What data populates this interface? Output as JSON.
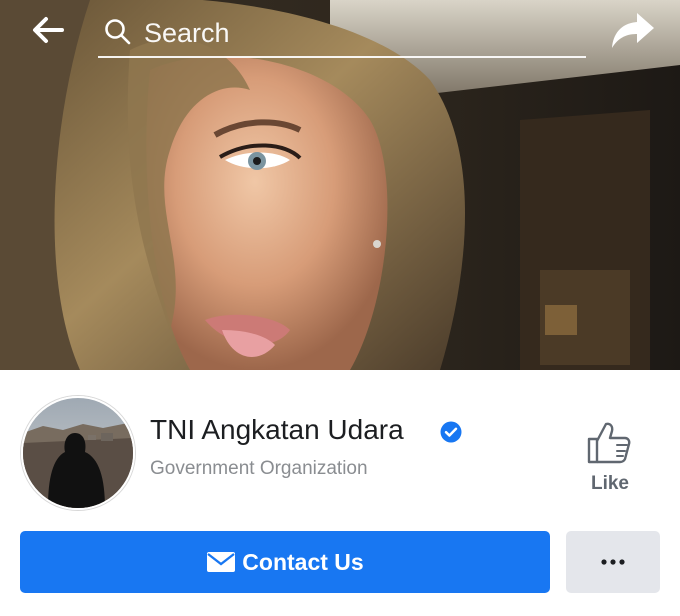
{
  "header": {
    "back_icon": "arrow-left-icon",
    "search_placeholder": "Search",
    "search_icon": "search-icon",
    "share_icon": "share-arrow-icon"
  },
  "profile": {
    "name": "TNI Angkatan Udara",
    "verified": true,
    "category": "Government Organization",
    "like_label": "Like"
  },
  "actions": {
    "contact_label": "Contact Us",
    "contact_icon": "envelope-icon",
    "more_icon": "ellipsis-icon"
  },
  "colors": {
    "primary": "#1877f2",
    "text": "#1c1e21",
    "secondary_text": "#8a8d91",
    "like_text": "#606770",
    "secondary_button": "#e4e6eb"
  }
}
